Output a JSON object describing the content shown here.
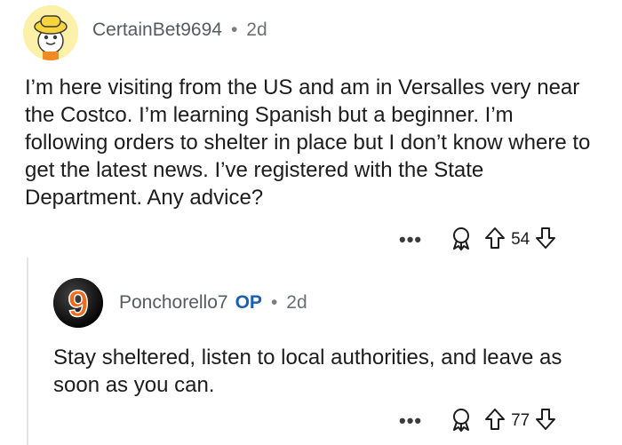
{
  "comment1": {
    "author": "CertainBet9694",
    "separator": "•",
    "time": "2d",
    "body": "I’m here visiting from the US and am in Versalles very near the Costco. I’m learning Spanish but a beginner. I’m following orders to shelter in place but I don’t know where to get the latest news. I’ve registered with the State Department. Any advice?",
    "score": "54",
    "more_label": "•••"
  },
  "comment2": {
    "author": "Ponchorello7",
    "op_badge": "OP",
    "separator": "•",
    "time": "2d",
    "body": "Stay sheltered, listen to local authorities, and leave as soon as you can.",
    "score": "77",
    "more_label": "•••",
    "avatar_text": "9"
  },
  "icons": [
    "snoo-avatar",
    "number-nine-avatar",
    "more-icon",
    "award-icon",
    "upvote-icon",
    "downvote-icon"
  ],
  "colors": {
    "op_badge": "#1a5fb4",
    "thread_line": "#e3e3e3"
  }
}
